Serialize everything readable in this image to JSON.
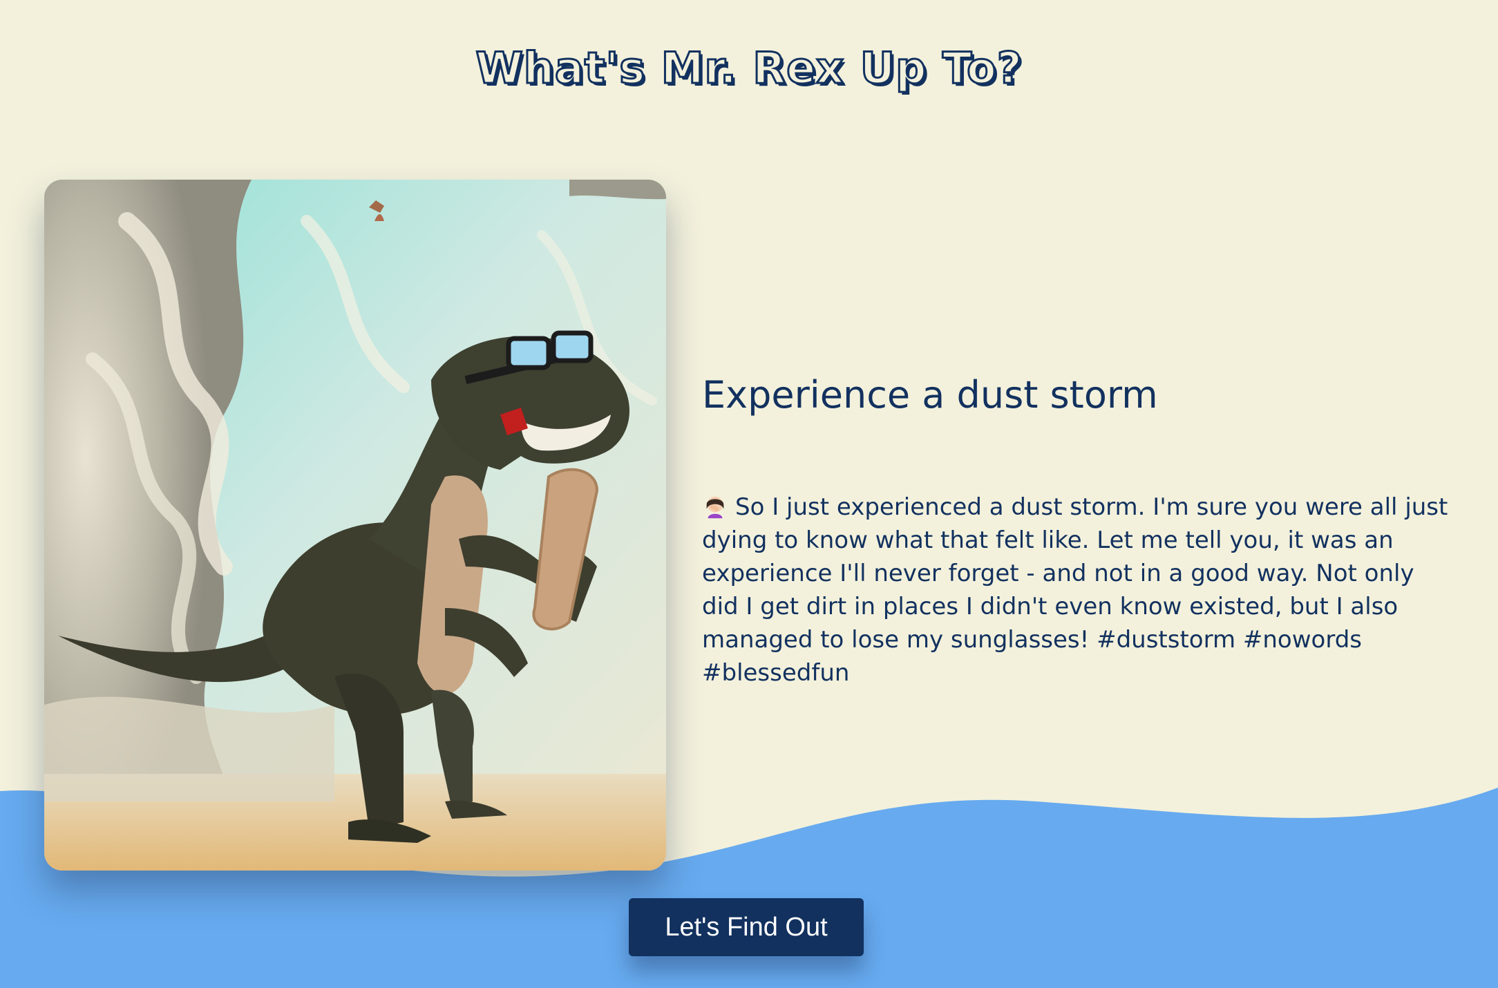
{
  "header": {
    "title": "What's Mr. Rex Up To?"
  },
  "image": {
    "icon": "dinosaur-illustration-icon"
  },
  "post": {
    "title": "Experience a dust storm",
    "emoji_icon": "woman-facepalming-icon",
    "body": "So I just experienced a dust storm. I'm sure you were all just dying to know what that felt like. Let me tell you, it was an experience I'll never forget - and not in a good way. Not only did I get dirt in places I didn't even know existed, but I also managed to lose my sunglasses! #duststorm #nowords #blessedfun"
  },
  "cta": {
    "label": "Let's Find Out"
  },
  "colors": {
    "background": "#f3f1dc",
    "wave": "#67aaef",
    "navy": "#12315f"
  }
}
